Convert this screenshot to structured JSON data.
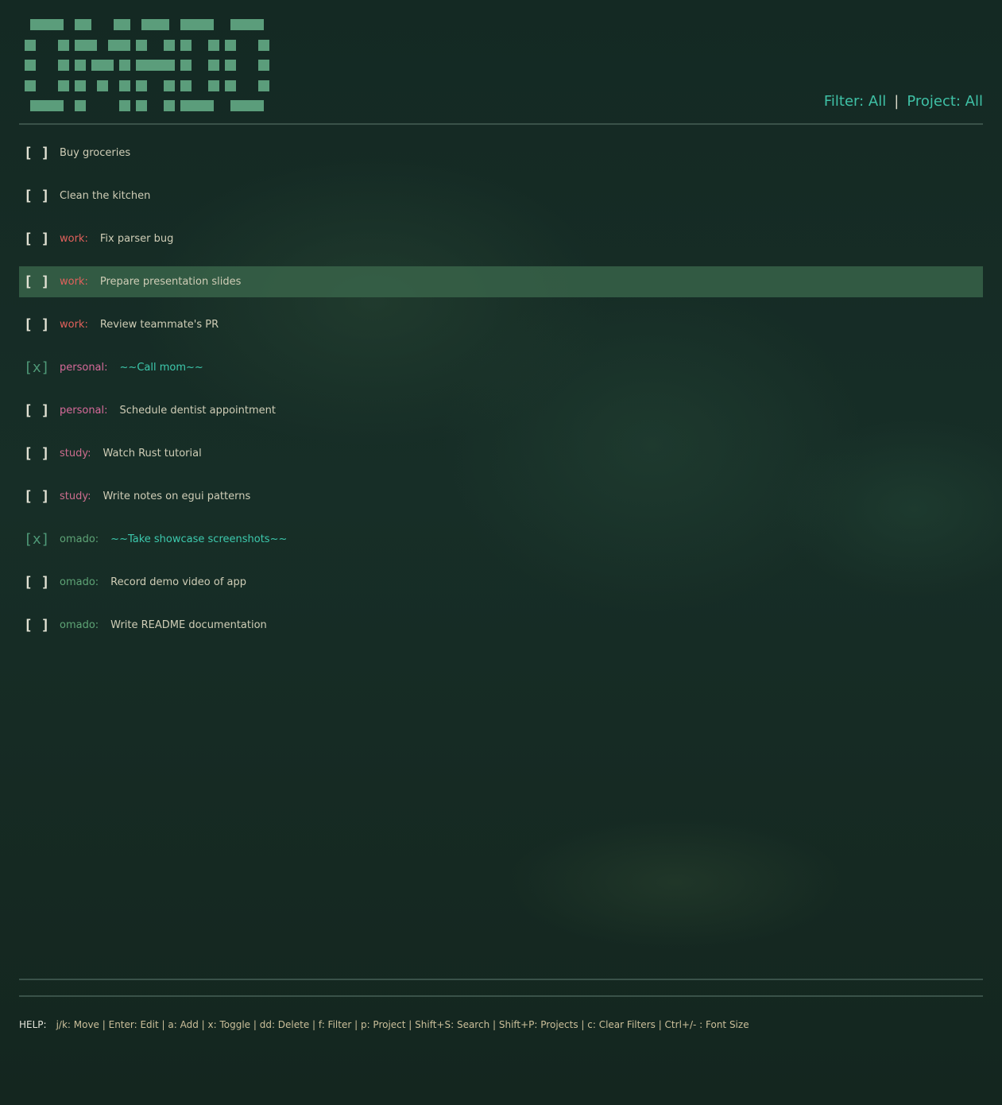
{
  "header": {
    "logo_alt": "OMADO",
    "filter_label": "Filter: All",
    "separator": "|",
    "project_label": "Project: All"
  },
  "tasks": [
    {
      "checkbox": "[ ]",
      "project": "",
      "project_class": "",
      "title": "Buy groceries",
      "done": false,
      "selected": false
    },
    {
      "checkbox": "[ ]",
      "project": "",
      "project_class": "",
      "title": "Clean the kitchen",
      "done": false,
      "selected": false
    },
    {
      "checkbox": "[ ]",
      "project": "work:",
      "project_class": "work",
      "title": "Fix parser bug",
      "done": false,
      "selected": false
    },
    {
      "checkbox": "[ ]",
      "project": "work:",
      "project_class": "work",
      "title": "Prepare presentation slides",
      "done": false,
      "selected": true
    },
    {
      "checkbox": "[ ]",
      "project": "work:",
      "project_class": "work",
      "title": "Review teammate's PR",
      "done": false,
      "selected": false
    },
    {
      "checkbox": "[x]",
      "project": "personal:",
      "project_class": "personal",
      "title": "~~Call mom~~",
      "done": true,
      "selected": false
    },
    {
      "checkbox": "[ ]",
      "project": "personal:",
      "project_class": "personal",
      "title": "Schedule dentist appointment",
      "done": false,
      "selected": false
    },
    {
      "checkbox": "[ ]",
      "project": "study:",
      "project_class": "study",
      "title": "Watch Rust tutorial",
      "done": false,
      "selected": false
    },
    {
      "checkbox": "[ ]",
      "project": "study:",
      "project_class": "study",
      "title": "Write notes on egui patterns",
      "done": false,
      "selected": false
    },
    {
      "checkbox": "[x]",
      "project": "omado:",
      "project_class": "omado",
      "title": "~~Take showcase screenshots~~",
      "done": true,
      "selected": false
    },
    {
      "checkbox": "[ ]",
      "project": "omado:",
      "project_class": "omado",
      "title": "Record demo video of app",
      "done": false,
      "selected": false
    },
    {
      "checkbox": "[ ]",
      "project": "omado:",
      "project_class": "omado",
      "title": "Write README documentation",
      "done": false,
      "selected": false
    }
  ],
  "help": {
    "label": "HELP:",
    "text": "j/k: Move | Enter: Edit | a: Add | x: Toggle | dd: Delete | f: Filter | p: Project | Shift+S: Search | Shift+P: Projects | c: Clear Filters | Ctrl+/- : Font Size"
  },
  "colors": {
    "accent": "#3fc1a6",
    "logo": "#5b9d7b",
    "selected_row": "#3c694e",
    "work": "#e2615c",
    "personal": "#d66a9a",
    "study": "#cd6d8e",
    "omado": "#5ea476"
  }
}
